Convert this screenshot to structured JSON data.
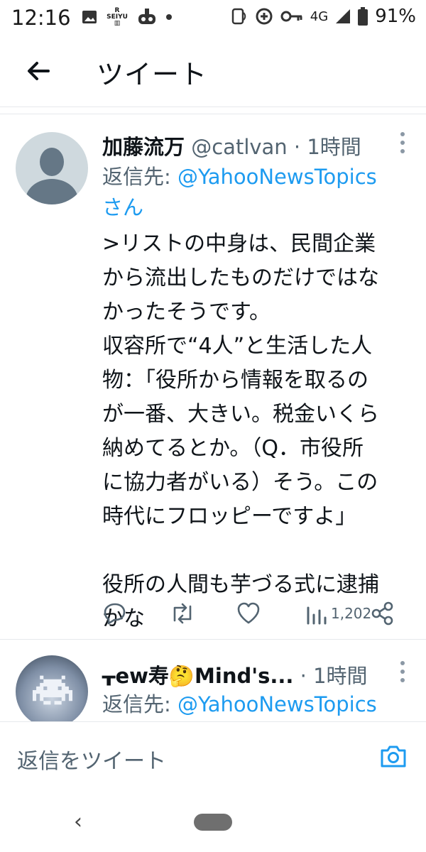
{
  "status_bar": {
    "time": "12:16",
    "network": "4G",
    "battery": "91%",
    "left_icons": [
      "image-icon",
      "rakuten-seiyu-icon",
      "game-icon",
      "dot-icon"
    ],
    "right_icons": [
      "nfc-icon",
      "data-saver-icon",
      "key-icon",
      "signal-icon",
      "battery-icon"
    ]
  },
  "header": {
    "title": "ツイート"
  },
  "tweets": [
    {
      "display_name": "加藤流万",
      "handle": "@catlvan",
      "time": "· 1時間",
      "reply_prefix": "返信先: ",
      "reply_to": "@YahooNewsTopics",
      "reply_suffix": "さん",
      "body": ">リストの中身は、民間企業\nから流出したものだけではな\nかったそうです。\n収容所で“4人”と生活した人\n物：「役所から情報を取るの\nが一番、大きい。税金いくら\n納めてるとか。（Q．市役所\nに協力者がいる）そう。この\n時代にフロッピーですよ」\n\n役所の人間も芋づる式に逮捕\nかな",
      "views": "1,202"
    },
    {
      "display_name": "ᚁew寿🤔Mind's...",
      "time": "· 1時間",
      "reply_prefix": "返信先: ",
      "reply_to": "@YahooNewsTopics"
    }
  ],
  "compose": {
    "placeholder": "返信をツイート"
  },
  "colors": {
    "accent": "#1d9bf0",
    "secondary_text": "#536471",
    "divider": "#e6e9ec"
  }
}
